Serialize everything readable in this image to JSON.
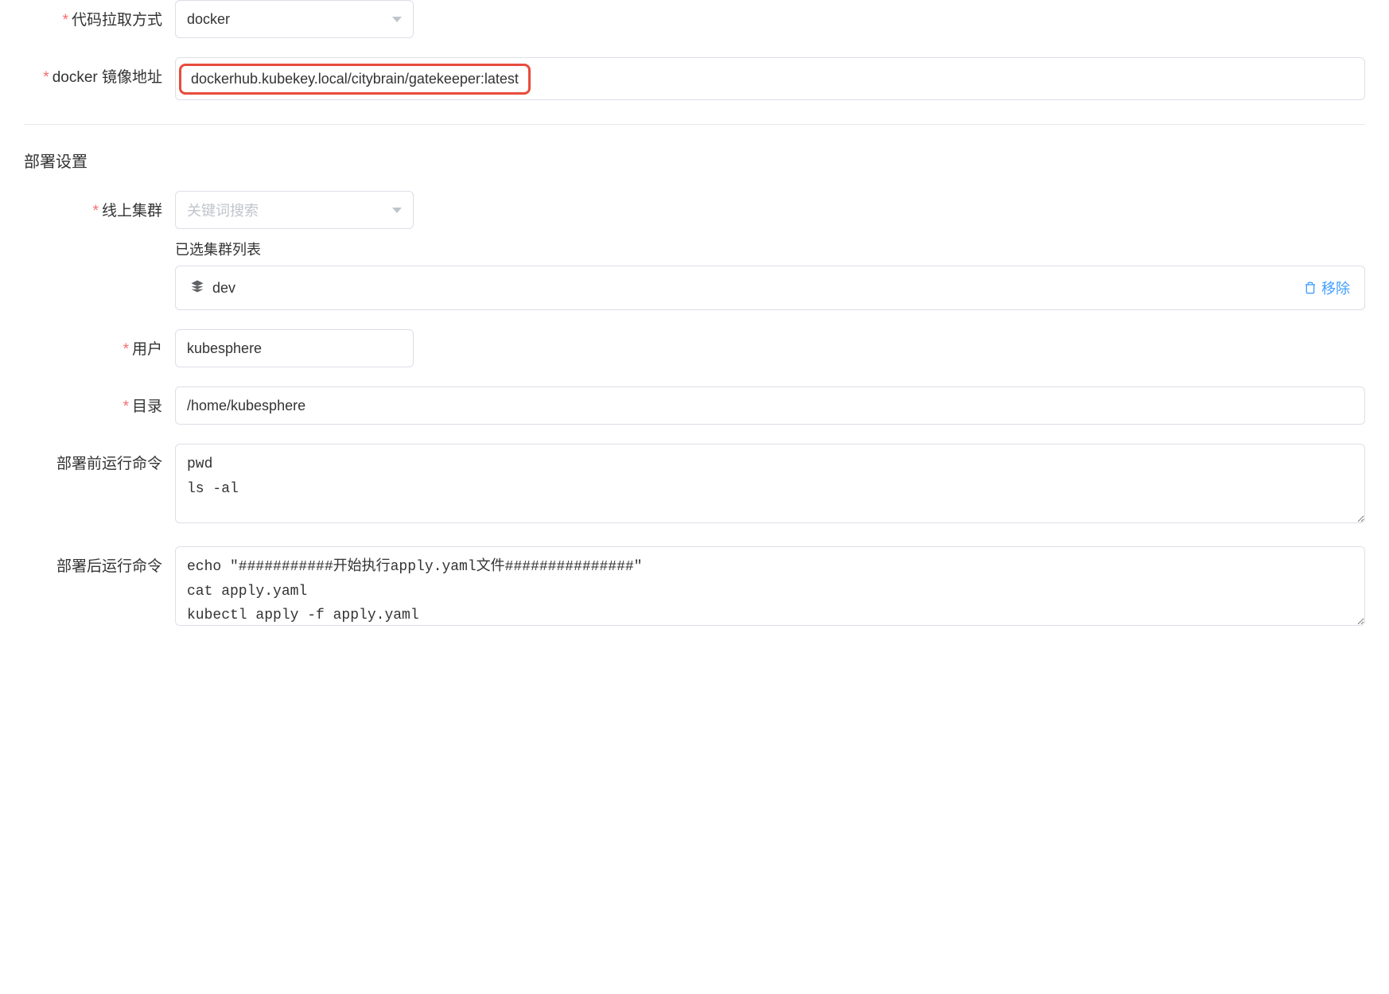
{
  "code_pull": {
    "label": "代码拉取方式",
    "value": "docker"
  },
  "docker_image": {
    "label": "docker 镜像地址",
    "value": "dockerhub.kubekey.local/citybrain/gatekeeper:latest"
  },
  "deploy_section": {
    "title": "部署设置"
  },
  "cluster": {
    "label": "线上集群",
    "placeholder": "关键词搜索",
    "selected_list_label": "已选集群列表",
    "items": [
      {
        "name": "dev",
        "remove_label": "移除"
      }
    ]
  },
  "user": {
    "label": "用户",
    "value": "kubesphere"
  },
  "directory": {
    "label": "目录",
    "value": "/home/kubesphere"
  },
  "pre_deploy": {
    "label": "部署前运行命令",
    "value": "pwd\nls -al"
  },
  "post_deploy": {
    "label": "部署后运行命令",
    "value": "echo \"###########开始执行apply.yaml文件###############\"\ncat apply.yaml\nkubectl apply -f apply.yaml"
  }
}
